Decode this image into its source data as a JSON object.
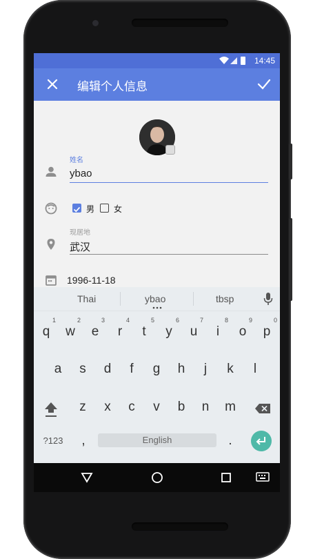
{
  "status_bar": {
    "time": "14:45"
  },
  "app_bar": {
    "title": "编辑个人信息"
  },
  "form": {
    "name": {
      "label": "姓名",
      "value": "ybao"
    },
    "gender": {
      "male_label": "男",
      "female_label": "女",
      "male_checked": true,
      "female_checked": false
    },
    "residence": {
      "label": "现居地",
      "value": "武汉"
    },
    "birthday": {
      "value": "1996-11-18"
    }
  },
  "keyboard": {
    "suggestions": [
      "Thai",
      "ybao",
      "tbsp"
    ],
    "row1": [
      "q",
      "w",
      "e",
      "r",
      "t",
      "y",
      "u",
      "i",
      "o",
      "p"
    ],
    "row1_hints": [
      "1",
      "2",
      "3",
      "4",
      "5",
      "6",
      "7",
      "8",
      "9",
      "0"
    ],
    "row2": [
      "a",
      "s",
      "d",
      "f",
      "g",
      "h",
      "j",
      "k",
      "l"
    ],
    "row3": [
      "z",
      "x",
      "c",
      "v",
      "b",
      "n",
      "m"
    ],
    "symbols_key": "?123",
    "comma_key": ",",
    "space_label": "English",
    "period_key": "."
  },
  "colors": {
    "primary": "#5c7fe0",
    "status_bar": "#4f6fd6",
    "enter_key": "#4fb9a8"
  },
  "icons": [
    "close-icon",
    "check-icon",
    "person-icon",
    "face-icon",
    "location-icon",
    "calendar-icon",
    "mic-icon",
    "shift-icon",
    "backspace-icon",
    "enter-icon",
    "back-nav-icon",
    "home-nav-icon",
    "recents-nav-icon",
    "keyboard-switch-icon",
    "wifi-icon",
    "signal-icon",
    "battery-icon",
    "camera-icon"
  ]
}
